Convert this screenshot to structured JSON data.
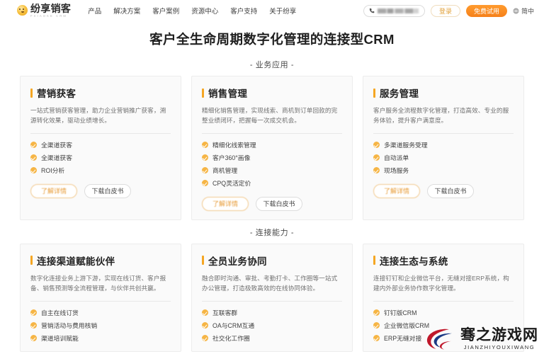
{
  "header": {
    "logo_name": "纷享销客",
    "logo_sub": "FXIAOKE CRM",
    "nav": [
      {
        "label": "产品"
      },
      {
        "label": "解决方案"
      },
      {
        "label": "客户案例"
      },
      {
        "label": "资源中心"
      },
      {
        "label": "客户支持"
      },
      {
        "label": "关于纷享"
      }
    ],
    "phone_icon": "phone-icon",
    "phone_number": "",
    "login_label": "登录",
    "trial_label": "免费试用",
    "lang_icon": "globe-icon",
    "lang_label": "简中"
  },
  "page_title": "客户全生命周期数字化管理的连接型CRM",
  "sections": [
    {
      "label": "- 业务应用 -",
      "cards": [
        {
          "title": "营销获客",
          "desc": "一站式营销获客管理，助力企业营销推广获客，溯源转化效果，驱动业绩增长。",
          "features": [
            "全渠道获客",
            "全渠道获客",
            "ROI分析"
          ],
          "detail_label": "了解详情",
          "whitepaper_label": "下载白皮书"
        },
        {
          "title": "销售管理",
          "desc": "精细化销售管理，实现线索、商机到订单回款的完整业绩闭环，把握每一次成交机会。",
          "features": [
            "精细化线索管理",
            "客户360°画像",
            "商机管理",
            "CPQ灵活定价"
          ],
          "detail_label": "了解详情",
          "whitepaper_label": "下载白皮书"
        },
        {
          "title": "服务管理",
          "desc": "客户服务全流程数字化管理，打造高效、专业的服务体验，提升客户满意度。",
          "features": [
            "多渠道服务受理",
            "自动派单",
            "现场服务"
          ],
          "detail_label": "了解详情",
          "whitepaper_label": "下载白皮书"
        }
      ]
    },
    {
      "label": "- 连接能力 -",
      "cards": [
        {
          "title": "连接渠道赋能伙伴",
          "desc": "数字化连接业务上游下游，实现在线订货、客户报备、销售预测等全流程管理，与伙伴共创共赢。",
          "features": [
            "自主在线订货",
            "营销活动与费用核销",
            "渠道培训赋能"
          ]
        },
        {
          "title": "全员业务协同",
          "desc": "融合即时沟通、审批、考勤打卡、工作圈等一站式办公管理，打造极致高效的在线协同体验。",
          "features": [
            "互联客群",
            "OA与CRM互通",
            "社交化工作圈"
          ]
        },
        {
          "title": "连接生态与系统",
          "desc": "连接钉钉和企业微信平台，无缝对接ERP系统，构建内外部业务协作数字化管理。",
          "features": [
            "钉钉版CRM",
            "企业微信版CRM",
            "ERP无缝对接"
          ]
        }
      ]
    }
  ],
  "watermark": {
    "cn": "骞之游戏网",
    "en": "JIANZHIYOUXIWANG"
  },
  "colors": {
    "accent": "#f5a623",
    "trial_button": "#f5801a",
    "card_bg": "#fafafa",
    "text_primary": "#222222"
  }
}
